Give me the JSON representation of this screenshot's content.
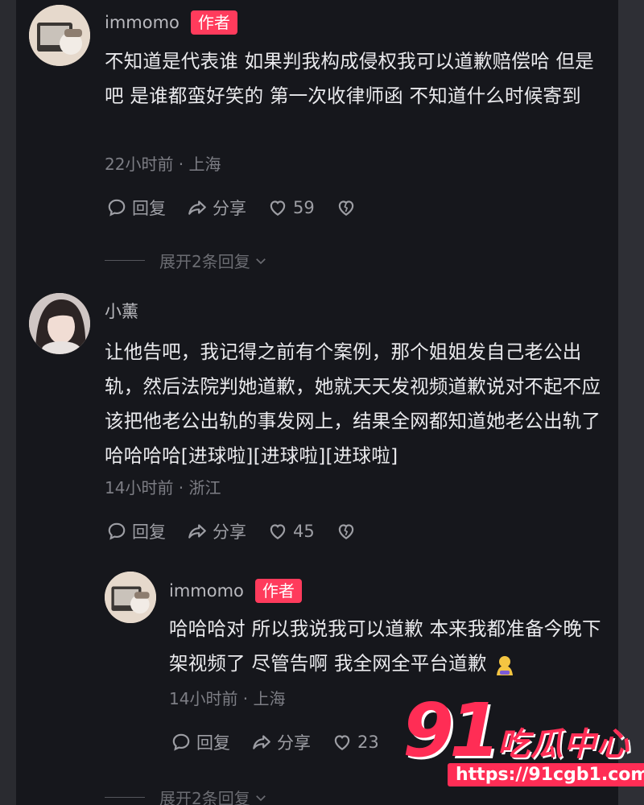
{
  "comments": [
    {
      "username": "immomo",
      "badge": "作者",
      "text": "不知道是代表谁 如果判我构成侵权我可以道歉赔偿哈 但是吧 是谁都蛮好笑的 第一次收律师函 不知道什么时候寄到",
      "meta": "22小时前 · 上海",
      "reply_label": "回复",
      "share_label": "分享",
      "likes": "59",
      "expand_label": "展开2条回复"
    },
    {
      "username": "小薰",
      "text": "让他告吧，我记得之前有个案例，那个姐姐发自己老公出轨，然后法院判她道歉，她就天天发视频道歉说对不起不应该把他老公出轨的事发网上，结果全网都知道她老公出轨了哈哈哈哈[进球啦][进球啦][进球啦]",
      "meta": "14小时前 · 浙江",
      "reply_label": "回复",
      "share_label": "分享",
      "likes": "45"
    },
    {
      "username": "immomo",
      "badge": "作者",
      "text": "哈哈哈对 所以我说我可以道歉 本来我都准备今晚下架视频了 尽管告啊 我全网全平台道歉",
      "meta": "14小时前 · 上海",
      "reply_label": "回复",
      "share_label": "分享",
      "likes": "23",
      "expand_label": "展开2条回复"
    }
  ],
  "watermark": {
    "number": "91",
    "name": "吃瓜中心",
    "url": "https://91cgb1.com"
  },
  "colors": {
    "background": "#16171c",
    "badge": "#ff3b5c",
    "watermark": "#ff2d55"
  },
  "icons": [
    "comment-icon",
    "share-icon",
    "heart-icon",
    "dislike-heart-icon",
    "chevron-down-icon",
    "bowing-emoji-icon"
  ]
}
